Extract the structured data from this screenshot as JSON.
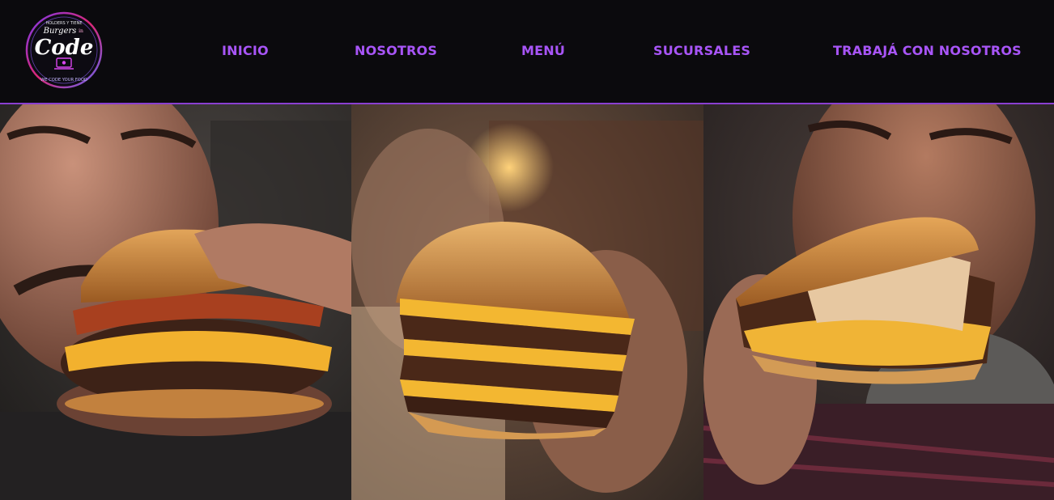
{
  "brand": {
    "logo_top_text": "HOLDERS Y TIENE",
    "logo_word_small": "Burgers",
    "logo_word_small_suffix": "in",
    "logo_word_main": "Code",
    "logo_tagline": "WE CODE YOUR FOOD",
    "accent_color": "#a855f7",
    "header_bg": "#0b0a0d"
  },
  "nav": {
    "items": [
      {
        "label": "INICIO"
      },
      {
        "label": "NOSOTROS"
      },
      {
        "label": "MENÚ"
      },
      {
        "label": "SUCURSALES"
      },
      {
        "label": "TRABAJÁ CON NOSOTROS"
      }
    ]
  },
  "gallery": {
    "panels": [
      {
        "subject": "man biting bacon cheeseburger"
      },
      {
        "subject": "hand holding triple cheeseburger"
      },
      {
        "subject": "bearded man biting loaded burger"
      }
    ]
  }
}
